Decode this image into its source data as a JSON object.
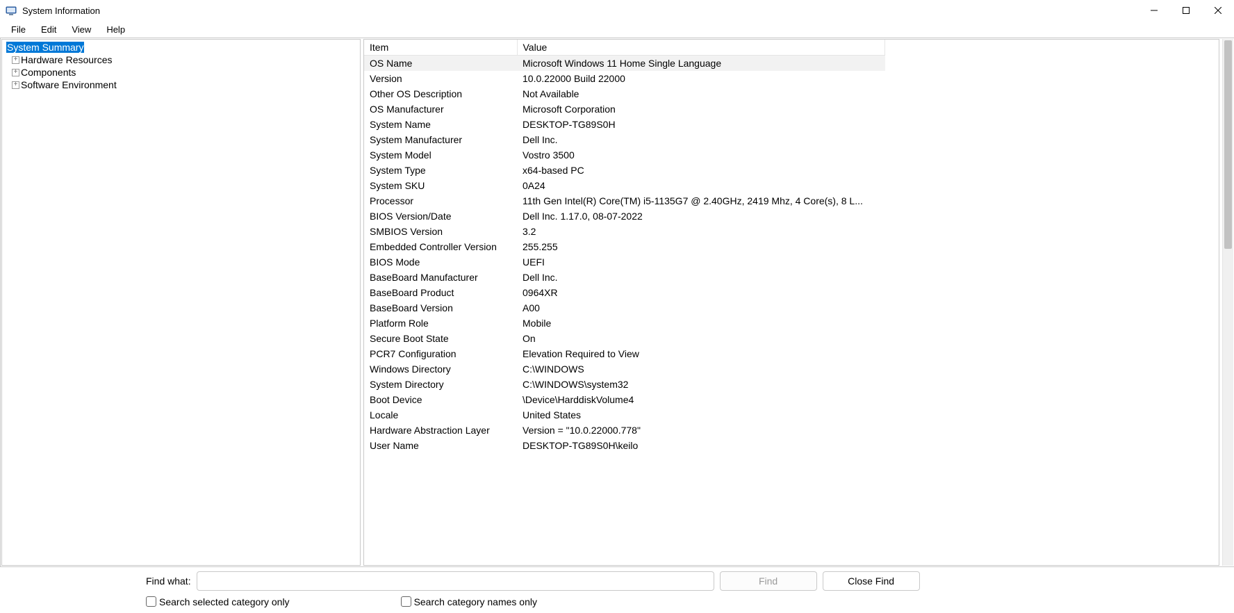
{
  "window": {
    "title": "System Information"
  },
  "menu": {
    "file": "File",
    "edit": "Edit",
    "view": "View",
    "help": "Help"
  },
  "tree": {
    "root": "System Summary",
    "children": [
      "Hardware Resources",
      "Components",
      "Software Environment"
    ]
  },
  "table": {
    "header_item": "Item",
    "header_value": "Value",
    "rows": [
      {
        "item": "OS Name",
        "value": "Microsoft Windows 11 Home Single Language",
        "hl": true
      },
      {
        "item": "Version",
        "value": "10.0.22000 Build 22000"
      },
      {
        "item": "Other OS Description",
        "value": "Not Available"
      },
      {
        "item": "OS Manufacturer",
        "value": "Microsoft Corporation"
      },
      {
        "item": "System Name",
        "value": "DESKTOP-TG89S0H"
      },
      {
        "item": "System Manufacturer",
        "value": "Dell Inc."
      },
      {
        "item": "System Model",
        "value": "Vostro 3500"
      },
      {
        "item": "System Type",
        "value": "x64-based PC"
      },
      {
        "item": "System SKU",
        "value": "0A24"
      },
      {
        "item": "Processor",
        "value": "11th Gen Intel(R) Core(TM) i5-1135G7 @ 2.40GHz, 2419 Mhz, 4 Core(s), 8 L..."
      },
      {
        "item": "BIOS Version/Date",
        "value": "Dell Inc. 1.17.0, 08-07-2022"
      },
      {
        "item": "SMBIOS Version",
        "value": "3.2"
      },
      {
        "item": "Embedded Controller Version",
        "value": "255.255"
      },
      {
        "item": "BIOS Mode",
        "value": "UEFI"
      },
      {
        "item": "BaseBoard Manufacturer",
        "value": "Dell Inc."
      },
      {
        "item": "BaseBoard Product",
        "value": "0964XR"
      },
      {
        "item": "BaseBoard Version",
        "value": "A00"
      },
      {
        "item": "Platform Role",
        "value": "Mobile"
      },
      {
        "item": "Secure Boot State",
        "value": "On"
      },
      {
        "item": "PCR7 Configuration",
        "value": "Elevation Required to View"
      },
      {
        "item": "Windows Directory",
        "value": "C:\\WINDOWS"
      },
      {
        "item": "System Directory",
        "value": "C:\\WINDOWS\\system32"
      },
      {
        "item": "Boot Device",
        "value": "\\Device\\HarddiskVolume4"
      },
      {
        "item": "Locale",
        "value": "United States"
      },
      {
        "item": "Hardware Abstraction Layer",
        "value": "Version = \"10.0.22000.778\""
      },
      {
        "item": "User Name",
        "value": "DESKTOP-TG89S0H\\keilo"
      }
    ]
  },
  "search": {
    "find_what_label": "Find what:",
    "find_button": "Find",
    "close_find_button": "Close Find",
    "opt_selected": "Search selected category only",
    "opt_names": "Search category names only",
    "input_value": ""
  }
}
